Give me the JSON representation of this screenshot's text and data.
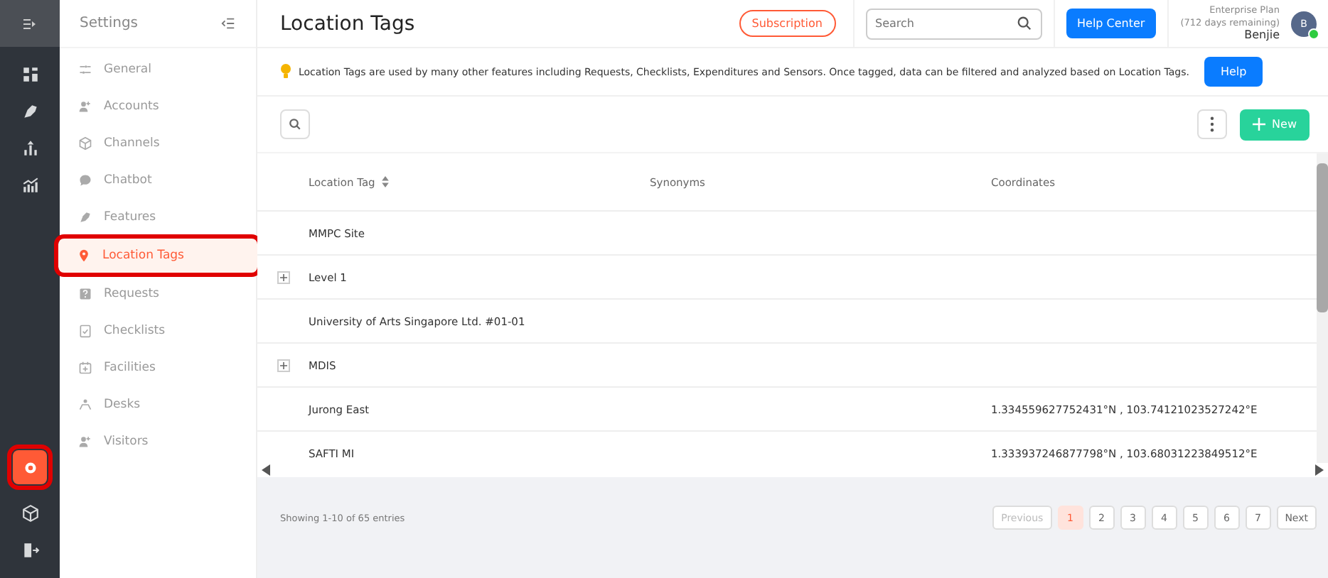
{
  "rail": {
    "items": [
      {
        "kind": "dashboard",
        "selected": false,
        "annotated": false
      },
      {
        "kind": "features",
        "selected": false,
        "annotated": false
      },
      {
        "kind": "upload",
        "selected": false,
        "annotated": false
      },
      {
        "kind": "analytics",
        "selected": false,
        "annotated": false
      }
    ],
    "bottom": [
      {
        "kind": "settings",
        "selected": true,
        "annotated": true
      },
      {
        "kind": "cube",
        "selected": false,
        "annotated": false
      },
      {
        "kind": "logout",
        "selected": false,
        "annotated": false
      }
    ]
  },
  "settings": {
    "title": "Settings",
    "items": [
      {
        "label": "General",
        "kind": "sliders",
        "selected": false,
        "annotated": false
      },
      {
        "label": "Accounts",
        "kind": "people",
        "selected": false,
        "annotated": false
      },
      {
        "label": "Channels",
        "kind": "cube",
        "selected": false,
        "annotated": false
      },
      {
        "label": "Chatbot",
        "kind": "chat",
        "selected": false,
        "annotated": false
      },
      {
        "label": "Features",
        "kind": "features",
        "selected": false,
        "annotated": false
      },
      {
        "label": "Location Tags",
        "kind": "pin",
        "selected": true,
        "annotated": true
      },
      {
        "label": "Requests",
        "kind": "question",
        "selected": false,
        "annotated": false
      },
      {
        "label": "Checklists",
        "kind": "check",
        "selected": false,
        "annotated": false
      },
      {
        "label": "Facilities",
        "kind": "calendar",
        "selected": false,
        "annotated": false
      },
      {
        "label": "Desks",
        "kind": "desk",
        "selected": false,
        "annotated": false
      },
      {
        "label": "Visitors",
        "kind": "people",
        "selected": false,
        "annotated": false
      }
    ]
  },
  "header": {
    "title": "Location Tags",
    "subscription": "Subscription",
    "search": {
      "placeholder": "Search"
    },
    "help_center": "Help Center",
    "plan": "Enterprise Plan",
    "remaining": "(712 days remaining)",
    "user": "Benjie",
    "avatar": "B"
  },
  "banner": {
    "text": "Location Tags are used by many other features including Requests, Checklists, Expenditures and Sensors. Once tagged, data can be filtered and analyzed based on Location Tags.",
    "button": "Help"
  },
  "toolbar": {
    "new_button": "New"
  },
  "table": {
    "columns": [
      "Location Tag",
      "Synonyms",
      "Coordinates"
    ],
    "rows": [
      {
        "name": "MMPC Site",
        "synonyms": "",
        "coordinates": "",
        "expandable": false
      },
      {
        "name": "Level 1",
        "synonyms": "",
        "coordinates": "",
        "expandable": true
      },
      {
        "name": "University of Arts Singapore Ltd. #01-01",
        "synonyms": "",
        "coordinates": "",
        "expandable": false
      },
      {
        "name": "MDIS",
        "synonyms": "",
        "coordinates": "",
        "expandable": true
      },
      {
        "name": "Jurong East",
        "synonyms": "",
        "coordinates": "1.334559627752431°N , 103.74121023527242°E",
        "expandable": false
      },
      {
        "name": "SAFTI MI",
        "synonyms": "",
        "coordinates": "1.333937246877798°N , 103.68031223849512°E",
        "expandable": false
      }
    ]
  },
  "footer": {
    "info": "Showing 1-10 of 65 entries",
    "pages": [
      {
        "label": "Previous",
        "selected": false,
        "disabled": true
      },
      {
        "label": "1",
        "selected": true,
        "disabled": false
      },
      {
        "label": "2",
        "selected": false,
        "disabled": false
      },
      {
        "label": "3",
        "selected": false,
        "disabled": false
      },
      {
        "label": "4",
        "selected": false,
        "disabled": false
      },
      {
        "label": "5",
        "selected": false,
        "disabled": false
      },
      {
        "label": "6",
        "selected": false,
        "disabled": false
      },
      {
        "label": "7",
        "selected": false,
        "disabled": false
      },
      {
        "label": "Next",
        "selected": false,
        "disabled": false
      }
    ]
  }
}
